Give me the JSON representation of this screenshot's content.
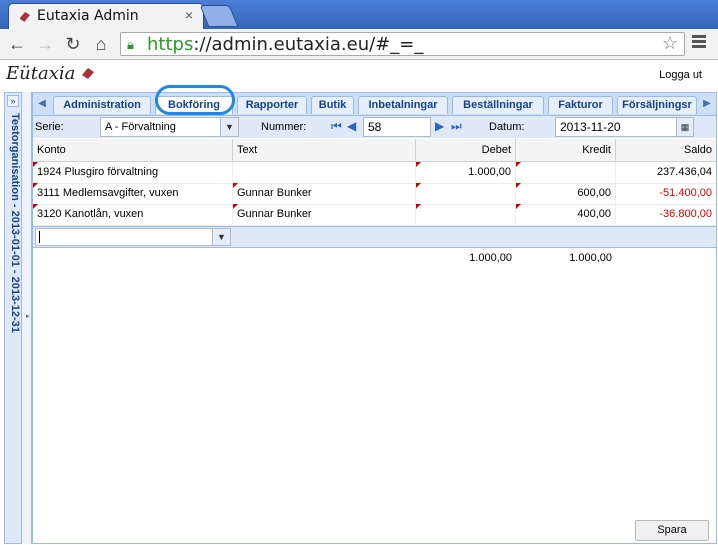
{
  "browser": {
    "tab_title": "Eutaxia Admin",
    "url_scheme": "https",
    "url_rest": "://admin.eutaxia.eu/#_=_"
  },
  "app": {
    "logo": "Eütaxia",
    "logout": "Logga ut",
    "side_panel_title": "Testorganisation - 2013-01-01 - 2013-12-31"
  },
  "tabs": [
    {
      "label": "Administration"
    },
    {
      "label": "Bokföring",
      "active": true
    },
    {
      "label": "Rapporter"
    },
    {
      "label": "Butik"
    },
    {
      "label": "Inbetalningar"
    },
    {
      "label": "Beställningar"
    },
    {
      "label": "Fakturor"
    },
    {
      "label": "Försäljningsr"
    }
  ],
  "form": {
    "serie_label": "Serie:",
    "serie_value": "A - Förvaltning",
    "nummer_label": "Nummer:",
    "nummer_value": "58",
    "datum_label": "Datum:",
    "datum_value": "2013-11-20"
  },
  "grid": {
    "columns": [
      "Konto",
      "Text",
      "Debet",
      "Kredit",
      "Saldo"
    ],
    "rows": [
      {
        "konto": "1924 Plusgiro förvaltning",
        "text": "",
        "debet": "1.000,00",
        "kredit": "",
        "saldo": "237.436,04",
        "negative": false
      },
      {
        "konto": "3111 Medlemsavgifter, vuxen",
        "text": "Gunnar Bunker",
        "debet": "",
        "kredit": "600,00",
        "saldo": "-51.400,00",
        "negative": true
      },
      {
        "konto": "3120 Kanotlån, vuxen",
        "text": "Gunnar Bunker",
        "debet": "",
        "kredit": "400,00",
        "saldo": "-36.800,00",
        "negative": true
      }
    ],
    "totals": {
      "debet": "1.000,00",
      "kredit": "1.000,00"
    }
  },
  "footer": {
    "save_label": "Spara"
  }
}
